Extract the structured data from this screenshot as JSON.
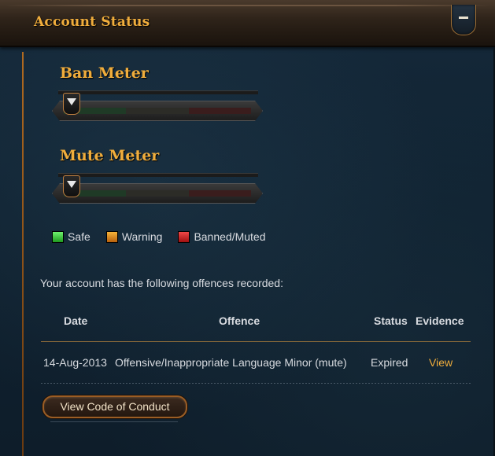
{
  "header": {
    "title": "Account Status"
  },
  "meters": [
    {
      "title": "Ban Meter",
      "level": 0
    },
    {
      "title": "Mute Meter",
      "level": 0
    }
  ],
  "legend": [
    {
      "label": "Safe",
      "color": "#2ec42e"
    },
    {
      "label": "Warning",
      "color": "#e08a1a"
    },
    {
      "label": "Banned/Muted",
      "color": "#d42020"
    }
  ],
  "offences": {
    "intro": "Your account has the following offences recorded:",
    "columns": {
      "date": "Date",
      "offence": "Offence",
      "status": "Status",
      "evidence": "Evidence"
    },
    "rows": [
      {
        "date": "14-Aug-2013",
        "offence": "Offensive/Inappropriate Language Minor (mute)",
        "status": "Expired",
        "evidence": "View"
      }
    ]
  },
  "buttons": {
    "code_of_conduct": "View Code of Conduct"
  },
  "colors": {
    "accent": "#f0ad3c",
    "text": "#d8dbe0",
    "divider_gold": "#8a6a3a"
  }
}
